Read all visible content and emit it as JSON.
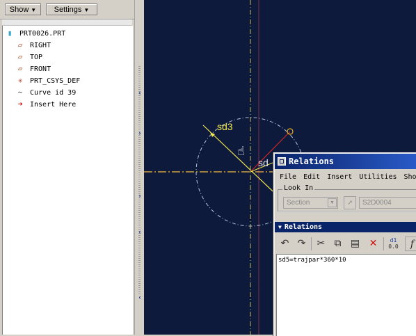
{
  "left_panel": {
    "toolbar": {
      "show_label": "Show",
      "settings_label": "Settings"
    },
    "tree": [
      {
        "label": "PRT0026.PRT",
        "icon": "part-icon"
      },
      {
        "label": "RIGHT",
        "icon": "datum-plane-icon"
      },
      {
        "label": "TOP",
        "icon": "datum-plane-icon"
      },
      {
        "label": "FRONT",
        "icon": "datum-plane-icon"
      },
      {
        "label": "PRT_CSYS_DEF",
        "icon": "coordinate-system-icon"
      },
      {
        "label": "Curve id 39",
        "icon": "curve-icon"
      },
      {
        "label": "Insert Here",
        "icon": "insert-arrow-icon"
      }
    ]
  },
  "canvas": {
    "background": "#0d1a3c",
    "dimension_sd3": "sd3",
    "dimension_partial": "sd"
  },
  "relations_dialog": {
    "title": "Relations",
    "menu": [
      "File",
      "Edit",
      "Insert",
      "Utilities",
      "Sho"
    ],
    "look_in": {
      "legend": "Look In",
      "type_select": "Section",
      "section_name": "S2D0004"
    },
    "section_header": "Relations",
    "toolbar_icons": [
      "undo-icon",
      "redo-icon",
      "cut-icon",
      "copy-icon",
      "paste-icon",
      "delete-icon",
      "dimension-toggle-icon",
      "function-icon"
    ],
    "d1_top": "d1",
    "d1_bottom": "0.0",
    "fx_label": "f",
    "relation_text": "sd5=trajpar*360*10"
  },
  "colors": {
    "title_bar": "#0a246a",
    "dimension_yellow": "#f1e84c",
    "delete_red": "#d01010"
  }
}
